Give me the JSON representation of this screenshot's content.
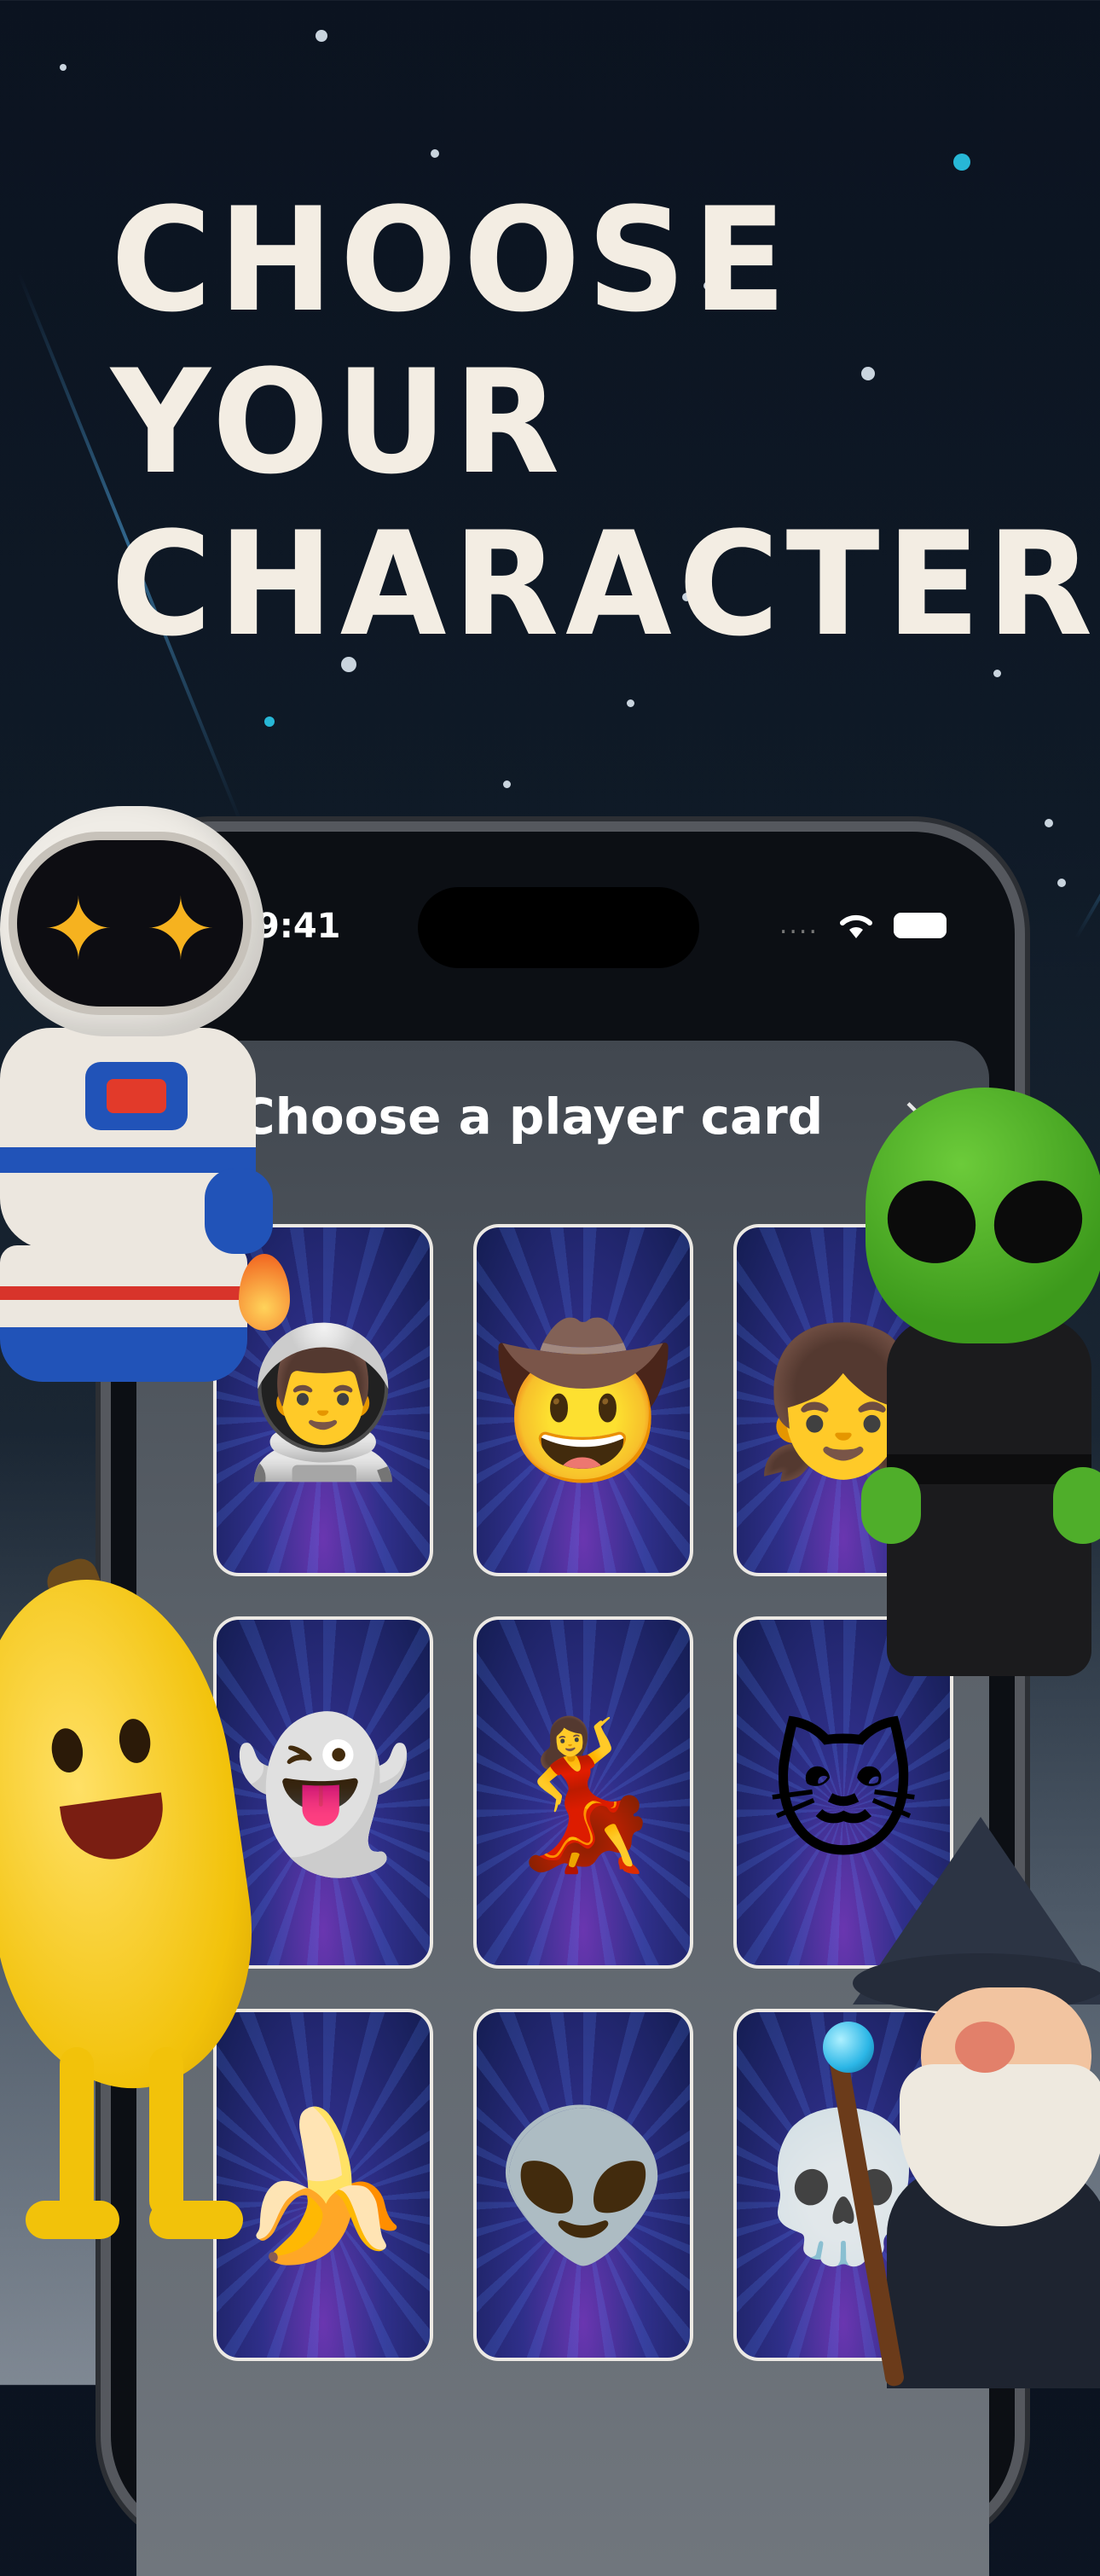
{
  "headline": {
    "line1": "CHOOSE",
    "line2": "YOUR",
    "line3": "CHARACTER"
  },
  "status_bar": {
    "time": "9:41",
    "signal": "....",
    "wifi_icon": "wifi-icon",
    "battery_icon": "battery-icon"
  },
  "sheet": {
    "title": "Choose a player card",
    "close": "×"
  },
  "cards": [
    {
      "name": "astronaut",
      "emoji": "👨‍🚀"
    },
    {
      "name": "explorer",
      "emoji": "🤠"
    },
    {
      "name": "adventurer-girl",
      "emoji": "👧"
    },
    {
      "name": "ghost",
      "emoji": "👻"
    },
    {
      "name": "disco-dancer",
      "emoji": "💃"
    },
    {
      "name": "cat",
      "emoji": "🐱"
    },
    {
      "name": "banana",
      "emoji": "🍌"
    },
    {
      "name": "alien",
      "emoji": "👽"
    },
    {
      "name": "skeleton",
      "emoji": "💀"
    }
  ]
}
